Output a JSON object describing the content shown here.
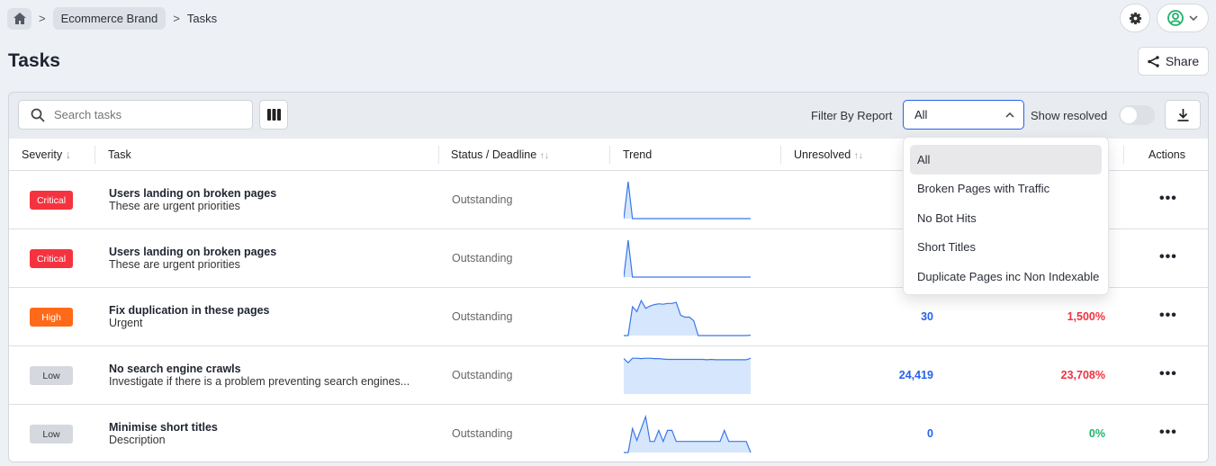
{
  "breadcrumb": {
    "home_icon": "home-icon",
    "items": [
      "Ecommerce Brand",
      "Tasks"
    ]
  },
  "page": {
    "title": "Tasks",
    "share_label": "Share"
  },
  "toolbar": {
    "search_placeholder": "Search tasks",
    "filter_label": "Filter By Report",
    "filter_value": "All",
    "show_resolved_label": "Show resolved",
    "show_resolved": false
  },
  "table": {
    "headers": {
      "severity": "Severity",
      "task": "Task",
      "status": "Status / Deadline",
      "trend": "Trend",
      "unresolved": "Unresolved",
      "actions": "Actions"
    },
    "rows": [
      {
        "severity": "Critical",
        "title": "Users landing on broken pages",
        "subtitle": "These are urgent priorities",
        "status": "Outstanding",
        "unresolved": "",
        "pct": "",
        "trend": [
          0,
          1,
          0,
          0,
          0,
          0,
          0,
          0,
          0,
          0,
          0,
          0,
          0,
          0,
          0,
          0,
          0,
          0,
          0,
          0,
          0,
          0,
          0,
          0,
          0,
          0,
          0,
          0,
          0,
          0
        ]
      },
      {
        "severity": "Critical",
        "title": "Users landing on broken pages",
        "subtitle": "These are urgent priorities",
        "status": "Outstanding",
        "unresolved": "",
        "pct": "",
        "trend": [
          0,
          1,
          0,
          0,
          0,
          0,
          0,
          0,
          0,
          0,
          0,
          0,
          0,
          0,
          0,
          0,
          0,
          0,
          0,
          0,
          0,
          0,
          0,
          0,
          0,
          0,
          0,
          0,
          0,
          0
        ]
      },
      {
        "severity": "High",
        "title": "Fix duplication in these pages",
        "subtitle": "Urgent",
        "status": "Outstanding",
        "unresolved": "30",
        "pct": "1,500%",
        "pct_color": "#ef3340",
        "trend": [
          0,
          0,
          0.78,
          0.65,
          0.95,
          0.74,
          0.8,
          0.84,
          0.86,
          0.85,
          0.87,
          0.87,
          0.9,
          0.55,
          0.5,
          0.5,
          0.4,
          0,
          0,
          0,
          0,
          0,
          0,
          0,
          0,
          0,
          0,
          0,
          0,
          0.01
        ]
      },
      {
        "severity": "Low",
        "title": "No search engine crawls",
        "subtitle": "Investigate if there is a problem preventing search engines...",
        "status": "Outstanding",
        "unresolved": "24,419",
        "pct": "23,708%",
        "pct_color": "#ef3340",
        "trend": [
          0.96,
          0.85,
          0.97,
          0.97,
          0.96,
          0.97,
          0.97,
          0.96,
          0.96,
          0.95,
          0.94,
          0.94,
          0.94,
          0.94,
          0.94,
          0.94,
          0.94,
          0.94,
          0.94,
          0.93,
          0.94,
          0.93,
          0.93,
          0.93,
          0.93,
          0.93,
          0.93,
          0.93,
          0.93,
          0.97
        ]
      },
      {
        "severity": "Low",
        "title": "Minimise short titles",
        "subtitle": "Description",
        "status": "Outstanding",
        "unresolved": "0",
        "pct": "0%",
        "pct_color": "#1fb36b",
        "trend": [
          0,
          0,
          0.65,
          0.33,
          0.65,
          0.97,
          0.3,
          0.3,
          0.6,
          0.3,
          0.6,
          0.6,
          0.3,
          0.3,
          0.3,
          0.3,
          0.3,
          0.3,
          0.3,
          0.3,
          0.3,
          0.3,
          0.3,
          0.6,
          0.3,
          0.3,
          0.3,
          0.3,
          0.3,
          0
        ]
      }
    ]
  },
  "severity_colors": {
    "Critical": "#f5333f",
    "High": "#ff6a1a",
    "Low": "#d5d8de"
  },
  "dropdown": {
    "options": [
      "All",
      "Broken Pages with Traffic",
      "No Bot Hits",
      "Short Titles",
      "Duplicate Pages inc Non Indexable"
    ],
    "selected": "All"
  }
}
